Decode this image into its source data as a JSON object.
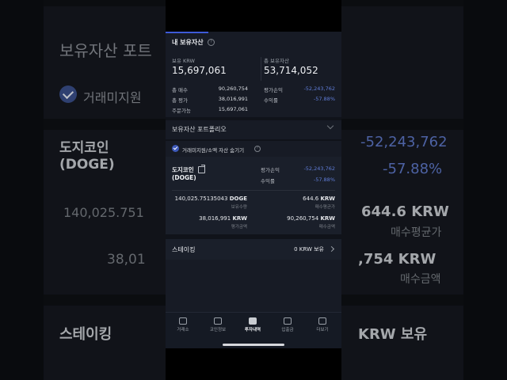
{
  "background": {
    "portfolio_text": "보유자산 포트",
    "checkbox_text": "거래미지원",
    "coin_name_line1": "도지코인",
    "coin_name_line2": "(DOGE)",
    "pnl": "-52,243,762",
    "rate": "-57.88%",
    "qty_partial": "140,025.751",
    "avg_price_partial": "644.6 KRW",
    "avg_price_label": "매수평균가",
    "eval_partial": "38,01",
    "buy_amount_partial": ",754 KRW",
    "buy_amount_label": "매수금액",
    "staking": "스테이킹",
    "staking_value_partial": "KRW 보유"
  },
  "summary": {
    "tab_label": "내 보유자산",
    "holdings_krw_label": "보유 KRW",
    "holdings_krw_value": "15,697,061",
    "total_assets_label": "총 보유자산",
    "total_assets_value": "53,714,052",
    "rows_left": [
      {
        "label": "총 매수",
        "value": "90,260,754"
      },
      {
        "label": "총 평가",
        "value": "38,016,991"
      },
      {
        "label": "주문가능",
        "value": "15,697,061"
      }
    ],
    "rows_right": [
      {
        "label": "평가손익",
        "value": "-52,243,762"
      },
      {
        "label": "수익률",
        "value": "-57.88%"
      }
    ]
  },
  "portfolio": {
    "title": "보유자산 포트폴리오",
    "hide_label": "거래미지원/소액 자산 숨기기"
  },
  "coin": {
    "name_line1": "도지코인",
    "name_line2": "(DOGE)",
    "pnl_label": "평가손익",
    "pnl_value": "-52,243,762",
    "rate_label": "수익률",
    "rate_value": "-57.88%",
    "qty_value": "140,025.75135043",
    "qty_unit": "DOGE",
    "qty_label": "보유수량",
    "avg_value": "644.6",
    "avg_unit": "KRW",
    "avg_label": "매수평균가",
    "eval_value": "38,016,991",
    "eval_unit": "KRW",
    "eval_label": "평가금액",
    "buy_value": "90,260,754",
    "buy_unit": "KRW",
    "buy_label": "매수금액"
  },
  "staking": {
    "title": "스테이킹",
    "value": "0 KRW 보유"
  },
  "nav": [
    {
      "label": "거래소",
      "icon": "home-icon"
    },
    {
      "label": "코인정보",
      "icon": "coin-info-icon"
    },
    {
      "label": "투자내역",
      "icon": "document-icon"
    },
    {
      "label": "입출금",
      "icon": "deposit-icon"
    },
    {
      "label": "더보기",
      "icon": "more-icon"
    }
  ],
  "colors": {
    "accent": "#3e5ad8",
    "negative": "#5f7cd6",
    "background": "#171b25"
  }
}
